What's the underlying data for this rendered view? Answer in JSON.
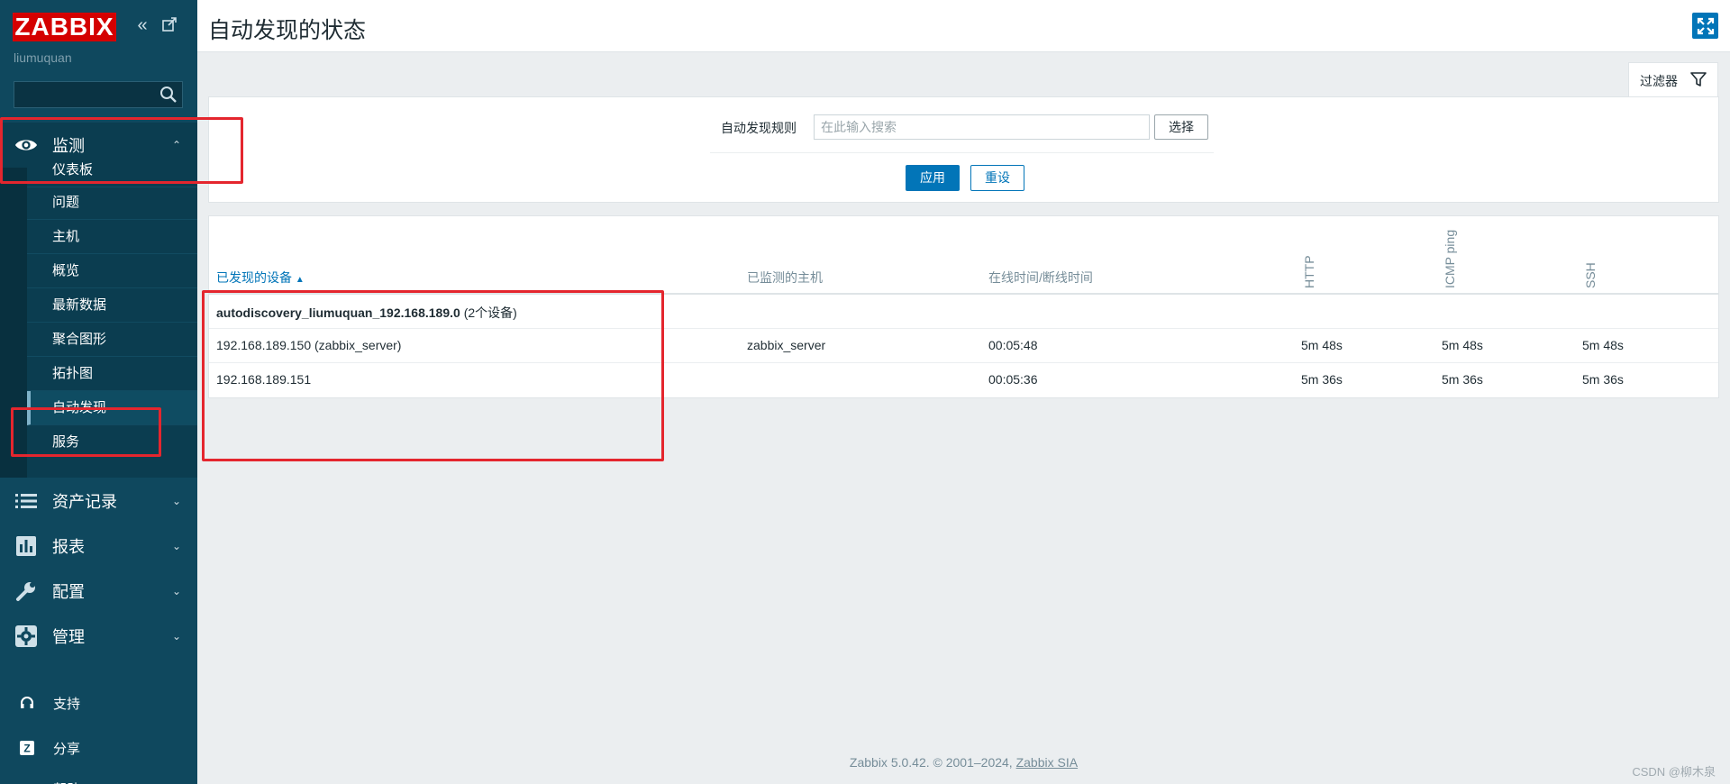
{
  "sidebar": {
    "logo": "ZABBIX",
    "user": "liumuquan",
    "monitor": {
      "label": "监测",
      "chev": "⌃"
    },
    "sub_items": [
      {
        "label": "仪表板"
      },
      {
        "label": "问题"
      },
      {
        "label": "主机"
      },
      {
        "label": "概览"
      },
      {
        "label": "最新数据"
      },
      {
        "label": "聚合图形"
      },
      {
        "label": "拓扑图"
      },
      {
        "label": "自动发现"
      },
      {
        "label": "服务"
      }
    ],
    "menus": [
      {
        "label": "资产记录",
        "icon": "list-icon"
      },
      {
        "label": "报表",
        "icon": "bar-chart-icon"
      },
      {
        "label": "配置",
        "icon": "wrench-icon"
      },
      {
        "label": "管理",
        "icon": "gear-icon"
      }
    ],
    "bottom": [
      {
        "label": "支持",
        "icon": "headset-icon"
      },
      {
        "label": "分享",
        "icon": "share-icon"
      },
      {
        "label": "帮助",
        "icon": "help-icon"
      }
    ]
  },
  "header": {
    "title": "自动发现的状态"
  },
  "filter": {
    "tab_label": "过滤器",
    "rule_label": "自动发现规则",
    "placeholder": "在此输入搜索",
    "select_label": "选择",
    "apply_label": "应用",
    "reset_label": "重设"
  },
  "table": {
    "headers": {
      "device": "已发现的设备",
      "sort_arrow": "▲",
      "host": "已监测的主机",
      "uptime": "在线时间/断线时间",
      "http": "HTTP",
      "icmp": "ICMP ping",
      "ssh": "SSH"
    },
    "group": {
      "name": "autodiscovery_liumuquan_192.168.189.0",
      "count": "(2个设备)"
    },
    "rows": [
      {
        "device": "192.168.189.150 (zabbix_server)",
        "host": "zabbix_server",
        "uptime": "00:05:48",
        "http": "5m 48s",
        "icmp": "5m 48s",
        "ssh": "5m 48s"
      },
      {
        "device": "192.168.189.151",
        "host": "",
        "uptime": "00:05:36",
        "http": "5m 36s",
        "icmp": "5m 36s",
        "ssh": "5m 36s"
      }
    ]
  },
  "footer": {
    "text": "Zabbix 5.0.42. © 2001–2024, ",
    "link": "Zabbix SIA"
  },
  "watermark": "CSDN @柳木泉",
  "colors": {
    "sidebar": "#0f485e",
    "brand_red": "#d40000",
    "accent_blue": "#0275b8",
    "annotation_red": "#e4262e"
  }
}
